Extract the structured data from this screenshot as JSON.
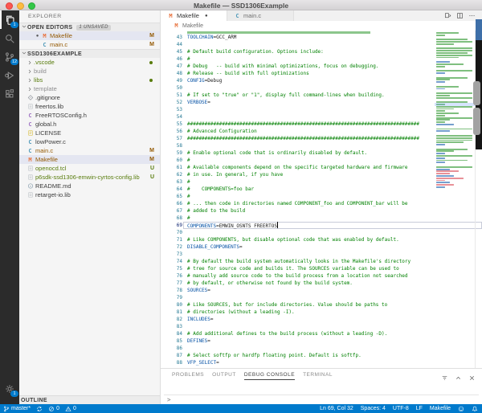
{
  "window": {
    "title": "Makefile — SSD1306Example"
  },
  "activity_bar": {
    "items": [
      {
        "id": "explorer",
        "icon": "files",
        "badge": "1",
        "active": true
      },
      {
        "id": "search",
        "icon": "search",
        "badge": "",
        "active": false
      },
      {
        "id": "source-control",
        "icon": "scm",
        "badge": "12",
        "active": false
      },
      {
        "id": "debug",
        "icon": "debug",
        "badge": "",
        "active": false
      },
      {
        "id": "extensions",
        "icon": "ext",
        "badge": "",
        "active": false
      }
    ],
    "bottom": {
      "id": "manage",
      "icon": "gear",
      "badge": "1"
    }
  },
  "sidebar": {
    "title": "EXPLORER",
    "open_editors": {
      "label": "OPEN EDITORS",
      "badge": "1 UNSAVED",
      "items": [
        {
          "name": "Makefile",
          "icon": "M",
          "dirty": true,
          "git": "M",
          "selected": true,
          "color": "modified"
        },
        {
          "name": "main.c",
          "icon": "C",
          "dirty": false,
          "git": "M",
          "selected": false,
          "color": "modified"
        }
      ]
    },
    "tree": {
      "label": "SSD1306EXAMPLE",
      "items": [
        {
          "name": ".vscode",
          "type": "folder",
          "color": "untracked",
          "dot": true
        },
        {
          "name": "build",
          "type": "folder",
          "color": "ignored",
          "dot": false
        },
        {
          "name": "libs",
          "type": "folder",
          "color": "untracked",
          "dot": true
        },
        {
          "name": "template",
          "type": "folder",
          "color": "ignored",
          "dot": false
        },
        {
          "name": ".gitignore",
          "type": "file",
          "icon": "git",
          "color": "",
          "git": ""
        },
        {
          "name": "freertos.lib",
          "type": "file",
          "icon": "doc",
          "color": "",
          "git": ""
        },
        {
          "name": "FreeRTOSConfig.h",
          "type": "file",
          "icon": "Cp",
          "color": "",
          "git": ""
        },
        {
          "name": "global.h",
          "type": "file",
          "icon": "Cp",
          "color": "",
          "git": ""
        },
        {
          "name": "LICENSE",
          "type": "file",
          "icon": "license",
          "color": "",
          "git": ""
        },
        {
          "name": "lowPower.c",
          "type": "file",
          "icon": "C",
          "color": "",
          "git": ""
        },
        {
          "name": "main.c",
          "type": "file",
          "icon": "C",
          "color": "modified",
          "git": "M"
        },
        {
          "name": "Makefile",
          "type": "file",
          "icon": "M",
          "color": "modified",
          "git": "M",
          "selected": true
        },
        {
          "name": "openocd.tcl",
          "type": "file",
          "icon": "doc",
          "color": "untracked",
          "git": "U"
        },
        {
          "name": "p6sdk-ssd1306-emwin-cyrtos-config.lib",
          "type": "file",
          "icon": "doc",
          "color": "untracked",
          "git": "U"
        },
        {
          "name": "README.md",
          "type": "file",
          "icon": "info",
          "color": "",
          "git": ""
        },
        {
          "name": "retarget-io.lib",
          "type": "file",
          "icon": "doc",
          "color": "",
          "git": ""
        }
      ]
    },
    "outline_label": "OUTLINE"
  },
  "editor": {
    "tabs": [
      {
        "label": "Makefile",
        "icon": "M",
        "dirty": true,
        "active": true
      },
      {
        "label": "main.c",
        "icon": "C",
        "dirty": false,
        "active": false
      }
    ],
    "actions": [
      "open-changes",
      "split-editor",
      "more-actions"
    ],
    "breadcrumb": {
      "icon": "M",
      "label": "Makefile"
    },
    "cursor": {
      "line": 69,
      "col": 32
    },
    "lines": [
      {
        "n": 43,
        "y": "a",
        "t": "TOOLCHAIN=GCC_ARM"
      },
      {
        "n": 44,
        "y": "b",
        "t": ""
      },
      {
        "n": 45,
        "y": "c",
        "t": "# Default build configuration. Options include:"
      },
      {
        "n": 46,
        "y": "c",
        "t": "#"
      },
      {
        "n": 47,
        "y": "c",
        "t": "# Debug   -- build with minimal optimizations, focus on debugging."
      },
      {
        "n": 48,
        "y": "c",
        "t": "# Release -- build with full optimizations"
      },
      {
        "n": 49,
        "y": "a",
        "t": "CONFIG=Debug"
      },
      {
        "n": 50,
        "y": "b",
        "t": ""
      },
      {
        "n": 51,
        "y": "c",
        "t": "# If set to \"true\" or \"1\", display full command-lines when building."
      },
      {
        "n": 52,
        "y": "a",
        "t": "VERBOSE="
      },
      {
        "n": 53,
        "y": "b",
        "t": ""
      },
      {
        "n": 54,
        "y": "b",
        "t": ""
      },
      {
        "n": 55,
        "y": "c",
        "t": "################################################################################"
      },
      {
        "n": 56,
        "y": "c",
        "t": "# Advanced Configuration"
      },
      {
        "n": 57,
        "y": "c",
        "t": "################################################################################"
      },
      {
        "n": 58,
        "y": "b",
        "t": ""
      },
      {
        "n": 59,
        "y": "c",
        "t": "# Enable optional code that is ordinarily disabled by default."
      },
      {
        "n": 60,
        "y": "c",
        "t": "#"
      },
      {
        "n": 61,
        "y": "c",
        "t": "# Available components depend on the specific targeted hardware and firmware"
      },
      {
        "n": 62,
        "y": "c",
        "t": "# in use. In general, if you have"
      },
      {
        "n": 63,
        "y": "c",
        "t": "#"
      },
      {
        "n": 64,
        "y": "c",
        "t": "#    COMPONENTS=foo bar"
      },
      {
        "n": 65,
        "y": "c",
        "t": "#"
      },
      {
        "n": 66,
        "y": "c",
        "t": "# ... then code in directories named COMPONENT_foo and COMPONENT_bar will be"
      },
      {
        "n": 67,
        "y": "c",
        "t": "# added to the build"
      },
      {
        "n": 68,
        "y": "c",
        "t": "#"
      },
      {
        "n": 69,
        "y": "a",
        "t": "COMPONENTS=EMWIN_OSNTS FREERTOS",
        "current": true
      },
      {
        "n": 70,
        "y": "b",
        "t": ""
      },
      {
        "n": 71,
        "y": "c",
        "t": "# Like COMPONENTS, but disable optional code that was enabled by default."
      },
      {
        "n": 72,
        "y": "a",
        "t": "DISABLE_COMPONENTS="
      },
      {
        "n": 73,
        "y": "b",
        "t": ""
      },
      {
        "n": 74,
        "y": "c",
        "t": "# By default the build system automatically looks in the Makefile's directory"
      },
      {
        "n": 75,
        "y": "c",
        "t": "# tree for source code and builds it. The SOURCES variable can be used to"
      },
      {
        "n": 76,
        "y": "c",
        "t": "# manually add source code to the build process from a location not searched"
      },
      {
        "n": 77,
        "y": "c",
        "t": "# by default, or otherwise not found by the build system."
      },
      {
        "n": 78,
        "y": "a",
        "t": "SOURCES="
      },
      {
        "n": 79,
        "y": "b",
        "t": ""
      },
      {
        "n": 80,
        "y": "c",
        "t": "# Like SOURCES, but for include directories. Value should be paths to"
      },
      {
        "n": 81,
        "y": "c",
        "t": "# directories (without a leading -I)."
      },
      {
        "n": 82,
        "y": "a",
        "t": "INCLUDES="
      },
      {
        "n": 83,
        "y": "b",
        "t": ""
      },
      {
        "n": 84,
        "y": "c",
        "t": "# Add additional defines to the build process (without a leading -D)."
      },
      {
        "n": 85,
        "y": "a",
        "t": "DEFINES="
      },
      {
        "n": 86,
        "y": "b",
        "t": ""
      },
      {
        "n": 87,
        "y": "c",
        "t": "# Select softfp or hardfp floating point. Default is softfp."
      },
      {
        "n": 88,
        "y": "a",
        "t": "VFP_SELECT="
      }
    ],
    "minimap_rows": [
      "g5",
      "g2",
      "_0",
      "g7",
      "g8",
      "g4",
      "_0",
      "g8",
      "g8",
      "g7",
      "g8",
      "g5",
      "_0",
      "b3",
      "g6",
      "g2",
      "_0",
      "g8",
      "b2",
      "_0",
      "g7",
      "g3",
      "b2",
      "_0",
      "g5",
      "b2",
      "_0",
      "g8",
      "g3",
      "g8",
      "_0",
      "g7",
      "g2",
      "g8",
      "g4",
      "g2",
      "g5",
      "g2",
      "g8",
      "g3",
      "g2",
      "b4",
      "_0",
      "g8",
      "b3",
      "_0",
      "g8",
      "g8",
      "g8",
      "g6",
      "b2",
      "_0",
      "g7",
      "g4",
      "b2",
      "g8",
      "b2",
      "g7",
      "b2",
      "_0",
      "g8",
      "b3",
      "p5",
      "p3",
      "b4",
      "p6",
      "p2",
      "b3",
      "p4",
      "b2"
    ],
    "minimap_current_band_pct": 45
  },
  "panel": {
    "tabs": [
      "PROBLEMS",
      "OUTPUT",
      "DEBUG CONSOLE",
      "TERMINAL"
    ],
    "active_tab": "DEBUG CONSOLE",
    "actions": [
      "filter",
      "chevup",
      "close"
    ],
    "prompt": ">"
  },
  "status_bar": {
    "left": [
      {
        "icon": "branch",
        "label": "master*"
      },
      {
        "icon": "sync",
        "label": ""
      },
      {
        "icon": "error",
        "label": "0"
      },
      {
        "icon": "warn",
        "label": "0"
      }
    ],
    "right": [
      "Ln 69, Col 32",
      "Spaces: 4",
      "UTF-8",
      "LF",
      "Makefile"
    ],
    "right_icons": [
      "smiley",
      "bell"
    ]
  },
  "colors": {
    "accent": "#007ACC",
    "activity_bar_bg": "#2B2B2B",
    "modified": "#945903",
    "untracked": "#587C0C",
    "ignored": "#8E8E90",
    "comment": "#008000",
    "variable": "#0451A5",
    "selection_bg": "#E4E6F1",
    "makefile_icon": "#E8703A",
    "c_icon_blue": "#519ABA",
    "c_icon_purple": "#A074C4"
  }
}
